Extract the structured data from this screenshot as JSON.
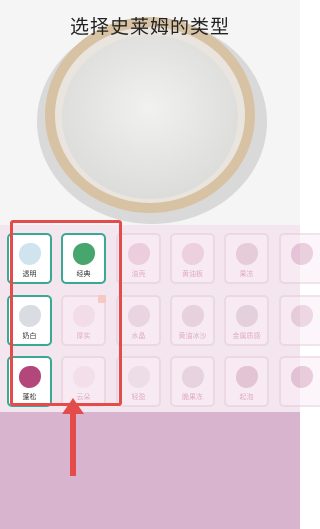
{
  "header": {
    "title": "选择史莱姆的类型"
  },
  "slime_types": [
    {
      "label": "透明",
      "state": "active",
      "color": "#cfe4ee"
    },
    {
      "label": "经典",
      "state": "active",
      "color": "#46a66e"
    },
    {
      "label": "油壳",
      "state": "locked",
      "color": "#e8b9cf"
    },
    {
      "label": "黄油板",
      "state": "locked",
      "color": "#e7bfcf"
    },
    {
      "label": "果冻",
      "state": "locked",
      "color": "#dab7c7"
    },
    {
      "label": "",
      "state": "locked",
      "color": "#d9a9c3"
    },
    {
      "label": "奶白",
      "state": "active",
      "color": "#d9dde2"
    },
    {
      "label": "厚实",
      "state": "locked",
      "color": "#f0d4e3"
    },
    {
      "label": "水晶",
      "state": "locked",
      "color": "#e3c6d6"
    },
    {
      "label": "黄油冰沙",
      "state": "locked",
      "color": "#ddc0cf"
    },
    {
      "label": "金属质感",
      "state": "locked",
      "color": "#d9bfcf"
    },
    {
      "label": "",
      "state": "locked",
      "color": "#ddb8cb"
    },
    {
      "label": "蓬松",
      "state": "active",
      "color": "#b3467a"
    },
    {
      "label": "云朵",
      "state": "locked",
      "color": "#f3dbe7"
    },
    {
      "label": "轻盈",
      "state": "locked",
      "color": "#e8d6e0"
    },
    {
      "label": "脆果冻",
      "state": "locked",
      "color": "#dcc5d3"
    },
    {
      "label": "起泡",
      "state": "locked",
      "color": "#d7a9bf"
    },
    {
      "label": "",
      "state": "locked",
      "color": "#d7a3c1"
    }
  ]
}
